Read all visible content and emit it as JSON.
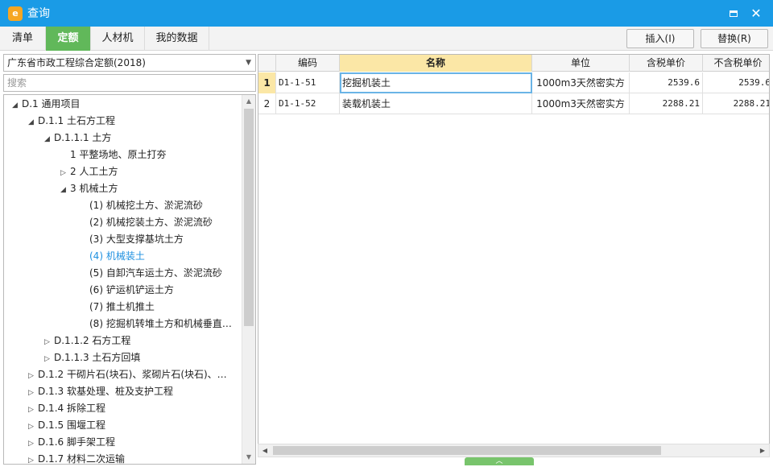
{
  "window": {
    "title": "查询",
    "logo_glyph": "e"
  },
  "tabs": [
    {
      "label": "清单",
      "active": false
    },
    {
      "label": "定额",
      "active": true
    },
    {
      "label": "人材机",
      "active": false
    },
    {
      "label": "我的数据",
      "active": false
    }
  ],
  "toolbar": {
    "insert_label": "插入(I)",
    "replace_label": "替换(R)"
  },
  "left": {
    "library_selected": "广东省市政工程综合定额(2018)",
    "search_placeholder": "搜索",
    "tree": [
      {
        "label": "D.1 通用项目",
        "level": 0,
        "toggle": "expanded"
      },
      {
        "label": "D.1.1 土石方工程",
        "level": 1,
        "toggle": "expanded"
      },
      {
        "label": "D.1.1.1 土方",
        "level": 2,
        "toggle": "expanded"
      },
      {
        "label": "1 平整场地、原土打夯",
        "level": 3,
        "toggle": "none"
      },
      {
        "label": "2 人工土方",
        "level": 3,
        "toggle": "collapsed"
      },
      {
        "label": "3 机械土方",
        "level": 3,
        "toggle": "expanded"
      },
      {
        "label": "(1) 机械挖土方、淤泥流砂",
        "level": 4,
        "toggle": "none"
      },
      {
        "label": "(2) 机械挖装土方、淤泥流砂",
        "level": 4,
        "toggle": "none"
      },
      {
        "label": "(3) 大型支撑基坑土方",
        "level": 4,
        "toggle": "none"
      },
      {
        "label": "(4) 机械装土",
        "level": 4,
        "toggle": "none",
        "selected": true
      },
      {
        "label": "(5) 自卸汽车运土方、淤泥流砂",
        "level": 4,
        "toggle": "none"
      },
      {
        "label": "(6) 铲运机铲运土方",
        "level": 4,
        "toggle": "none"
      },
      {
        "label": "(7) 推土机推土",
        "level": 4,
        "toggle": "none"
      },
      {
        "label": "(8) 挖掘机转堆土方和机械垂直…",
        "level": 4,
        "toggle": "none"
      },
      {
        "label": "D.1.1.2 石方工程",
        "level": 2,
        "toggle": "collapsed"
      },
      {
        "label": "D.1.1.3 土石方回填",
        "level": 2,
        "toggle": "collapsed"
      },
      {
        "label": "D.1.2 干砌片石(块石)、浆砌片石(块石)、…",
        "level": 1,
        "toggle": "collapsed"
      },
      {
        "label": "D.1.3 软基处理、桩及支护工程",
        "level": 1,
        "toggle": "collapsed"
      },
      {
        "label": "D.1.4 拆除工程",
        "level": 1,
        "toggle": "collapsed"
      },
      {
        "label": "D.1.5 围堰工程",
        "level": 1,
        "toggle": "collapsed"
      },
      {
        "label": "D.1.6 脚手架工程",
        "level": 1,
        "toggle": "collapsed"
      },
      {
        "label": "D.1.7 材料二次运输",
        "level": 1,
        "toggle": "collapsed"
      }
    ]
  },
  "grid": {
    "columns": [
      "",
      "编码",
      "名称",
      "单位",
      "含税单价",
      "不含税单价"
    ],
    "rows": [
      {
        "index": "1",
        "code": "D1-1-51",
        "name": "挖掘机装土",
        "unit": "1000m3天然密实方",
        "price_tax": "2539.6",
        "price_notax": "2539.6",
        "selected": true
      },
      {
        "index": "2",
        "code": "D1-1-52",
        "name": "装载机装土",
        "unit": "1000m3天然密实方",
        "price_tax": "2288.21",
        "price_notax": "2288.21",
        "selected": false
      }
    ]
  },
  "colors": {
    "titlebar": "#1a9be6",
    "active_tab": "#61b85a",
    "header_highlight": "#fbe7a6",
    "selected_text": "#1e90e0"
  }
}
